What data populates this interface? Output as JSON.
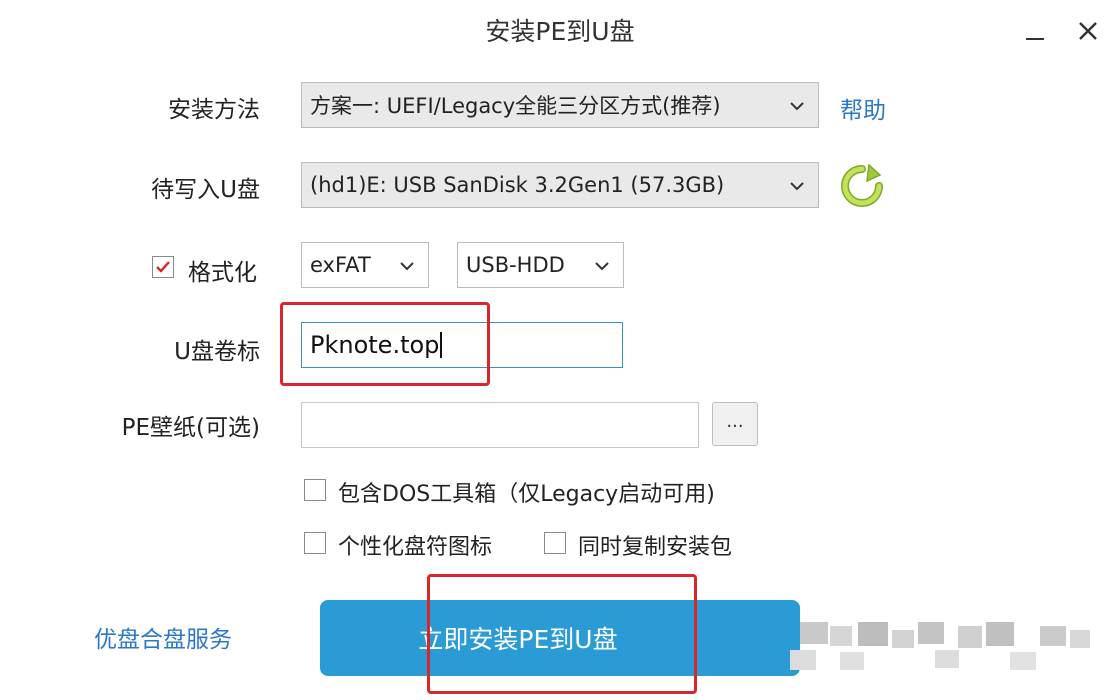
{
  "window": {
    "title": "安装PE到U盘",
    "minimize_icon": "minimize-icon",
    "close_icon": "close-icon"
  },
  "install_method": {
    "label": "安装方法",
    "selected": "方案一:  UEFI/Legacy全能三分区方式(推荐)",
    "help_link": "帮助"
  },
  "target_drive": {
    "label": "待写入U盘",
    "selected": "(hd1)E: USB  SanDisk 3.2Gen1 (57.3GB)",
    "refresh_icon": "refresh-icon"
  },
  "format": {
    "label": "格式化",
    "checked": true,
    "filesystem": "exFAT",
    "mode": "USB-HDD"
  },
  "volume_label": {
    "label": "U盘卷标",
    "value": "Pknote.top"
  },
  "wallpaper": {
    "label": "PE壁纸(可选)",
    "value": "",
    "browse_label": "..."
  },
  "options": {
    "dos_toolbox": {
      "label": "包含DOS工具箱（仅Legacy启动可用)",
      "checked": false
    },
    "custom_icon": {
      "label": "个性化盘符图标",
      "checked": false
    },
    "copy_package": {
      "label": "同时复制安装包",
      "checked": false
    }
  },
  "footer": {
    "service_link": "优盘合盘服务",
    "install_button": "立即安装PE到U盘"
  },
  "colors": {
    "accent": "#2a9bd5",
    "link": "#2b78c8",
    "highlight": "#d8262d",
    "refresh_icon": "#9fc83a"
  }
}
